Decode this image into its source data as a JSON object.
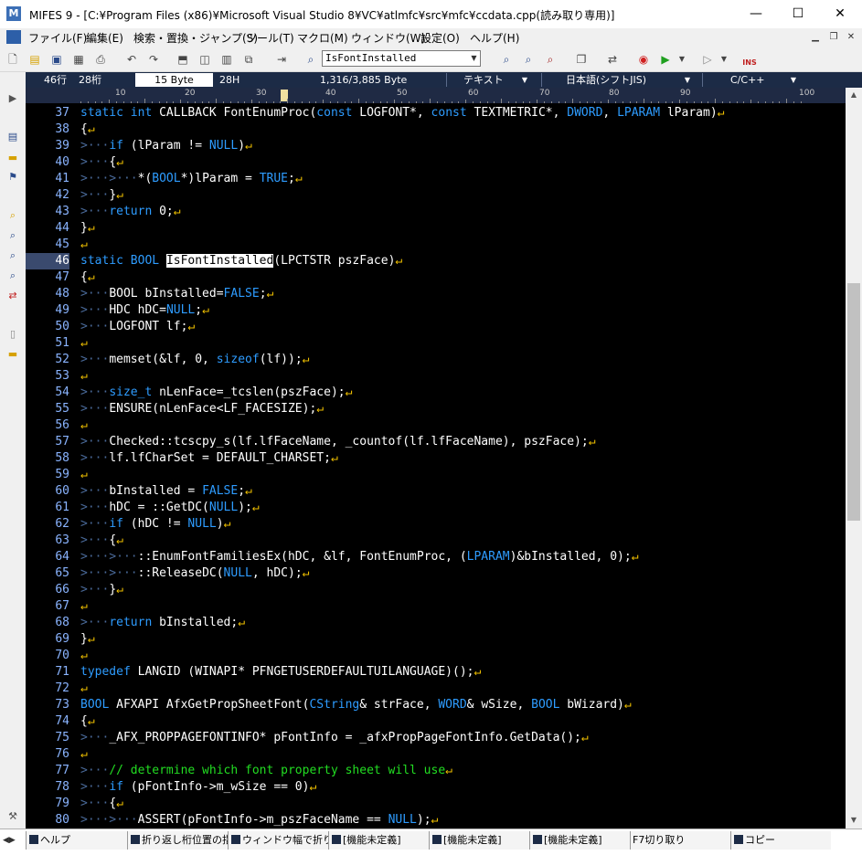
{
  "window": {
    "title": "MIFES 9 - [C:¥Program Files (x86)¥Microsoft Visual Studio 8¥VC¥atlmfc¥src¥mfc¥ccdata.cpp(読み取り専用)]",
    "app_icon": "M"
  },
  "menu": [
    "ファイル(F)",
    "編集(E)",
    "検索・置換・ジャンプ(S)",
    "ツール(T)",
    "マクロ(M)",
    "ウィンドウ(W)",
    "設定(O)",
    "ヘルプ(H)"
  ],
  "toolbar": {
    "search_value": "IsFontInstalled",
    "ins_label": "INS"
  },
  "status": {
    "line": "46行",
    "col": "28桁",
    "byte": "15 Byte",
    "hex": "28H",
    "size": "1,316/3,885 Byte",
    "mode": "テキスト",
    "encoding": "日本語(シフトJIS)",
    "lang": "C/C++"
  },
  "ruler": [
    "10",
    "20",
    "30",
    "40",
    "50",
    "60",
    "70",
    "80",
    "90",
    "100"
  ],
  "line_numbers": [
    "37",
    "38",
    "39",
    "40",
    "41",
    "42",
    "43",
    "44",
    "45",
    "46",
    "47",
    "48",
    "49",
    "50",
    "51",
    "52",
    "53",
    "54",
    "55",
    "56",
    "57",
    "58",
    "59",
    "60",
    "61",
    "62",
    "63",
    "64",
    "65",
    "66",
    "67",
    "68",
    "69",
    "70",
    "71",
    "72",
    "73",
    "74",
    "75",
    "76",
    "77",
    "78",
    "79",
    "80"
  ],
  "current_line": "46",
  "code": {
    "l37": [
      "static int",
      "CALLBACK FontEnumProc(",
      "const",
      "LOGFONT*, ",
      "const",
      "TEXTMETRIC*, ",
      "DWORD",
      ", ",
      "LPARAM",
      " lParam)"
    ],
    "l39": [
      "if",
      " (lParam != ",
      "NULL",
      ")"
    ],
    "l41": [
      "*(",
      "BOOL",
      "*)lParam = ",
      "TRUE",
      ";"
    ],
    "l43": [
      "return",
      " 0;"
    ],
    "l46": [
      "static",
      " BOOL ",
      "IsFontInstalled",
      "(LPCTSTR pszFace)"
    ],
    "l48": [
      "BOOL bInstalled=",
      "FALSE",
      ";"
    ],
    "l49": [
      "HDC hDC=",
      "NULL",
      ";"
    ],
    "l50": "LOGFONT lf;",
    "l52": [
      "memset(&lf, 0, ",
      "sizeof",
      "(lf));"
    ],
    "l54": [
      "size_t",
      " nLenFace=_tcslen(pszFace);"
    ],
    "l55": "ENSURE(nLenFace<LF_FACESIZE);",
    "l57": "Checked::tcscpy_s(lf.lfFaceName, _countof(lf.lfFaceName), pszFace);",
    "l58": "lf.lfCharSet = DEFAULT_CHARSET;",
    "l60": [
      "bInstalled = ",
      "FALSE",
      ";"
    ],
    "l61": [
      "hDC = ::GetDC(",
      "NULL",
      ");"
    ],
    "l62": [
      "if",
      " (hDC != ",
      "NULL",
      ")"
    ],
    "l64": [
      "::EnumFontFamiliesEx(hDC, &lf, FontEnumProc, (",
      "LPARAM",
      ")&bInstalled, 0);"
    ],
    "l65": [
      "::ReleaseDC(",
      "NULL",
      ", hDC);"
    ],
    "l68": [
      "return",
      " bInstalled;"
    ],
    "l71": [
      "typedef",
      " LANGID (WINAPI* PFNGETUSERDEFAULTUILANGUAGE)();"
    ],
    "l73": [
      "BOOL",
      " AFXAPI AfxGetPropSheetFont(",
      "CString",
      "& strFace, ",
      "WORD",
      "& wSize, ",
      "BOOL",
      " bWizard)"
    ],
    "l75": "_AFX_PROPPAGEFONTINFO* pFontInfo = _afxPropPageFontInfo.GetData();",
    "l77": "// determine which font property sheet will use",
    "l78": [
      "if",
      " (pFontInfo->m_wSize == 0)"
    ],
    "l80": [
      "ASSERT(pFontInfo->m_pszFaceName == ",
      "NULL",
      ");"
    ]
  },
  "fkeys": [
    "ヘルプ",
    "折り返し桁位置の指",
    "ウィンドウ幅で折り返",
    "[機能未定義]",
    "[機能未定義]",
    "[機能未定義]",
    "F7切り取り",
    "コピー"
  ],
  "colors": {
    "editor_bg": "#000000",
    "keyword": "#2e9cff",
    "comment": "#22dd22",
    "linenum": "#8ab4ff",
    "newline_mark": "#f0c000"
  }
}
